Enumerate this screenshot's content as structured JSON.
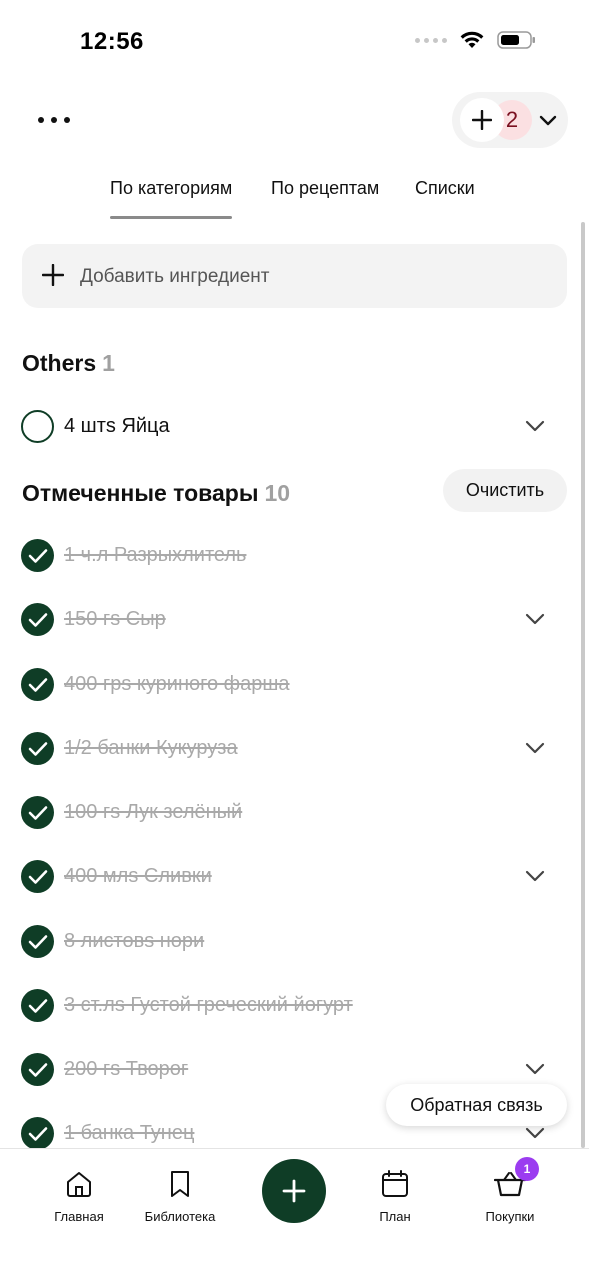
{
  "status_bar": {
    "time": "12:56"
  },
  "header": {
    "servings_count": "2"
  },
  "tabs": [
    {
      "label": "По категориям",
      "active": true
    },
    {
      "label": "По рецептам",
      "active": false
    },
    {
      "label": "Списки",
      "active": false
    }
  ],
  "add_ingredient": {
    "label": "Добавить ингредиент"
  },
  "sections": {
    "others": {
      "title": "Others",
      "count": "1",
      "items": [
        {
          "label": "4 штs Яйца",
          "checked": false,
          "expandable": true
        }
      ]
    },
    "checked": {
      "title": "Отмеченные товары",
      "count": "10",
      "clear_label": "Очистить",
      "items": [
        {
          "label": "1 ч.л Разрыхлитель",
          "checked": true,
          "expandable": false
        },
        {
          "label": "150 гs Сыр",
          "checked": true,
          "expandable": true
        },
        {
          "label": "400 грs куриного фарша",
          "checked": true,
          "expandable": false
        },
        {
          "label": "1/2 банки Кукуруза",
          "checked": true,
          "expandable": true
        },
        {
          "label": "100 гs Лук зелёный",
          "checked": true,
          "expandable": false
        },
        {
          "label": "400 млs Сливки",
          "checked": true,
          "expandable": true
        },
        {
          "label": "8 листовs нори",
          "checked": true,
          "expandable": false
        },
        {
          "label": "3 ст.лs Густой греческий йогурт",
          "checked": true,
          "expandable": false
        },
        {
          "label": "200 гs Творог",
          "checked": true,
          "expandable": true
        },
        {
          "label": "1 банка Тунец",
          "checked": true,
          "expandable": true
        }
      ]
    }
  },
  "feedback": {
    "label": "Обратная связь"
  },
  "bottom_nav": {
    "home": "Главная",
    "library": "Библиотека",
    "plan": "План",
    "shopping": "Покупки",
    "shopping_badge": "1"
  },
  "colors": {
    "accent": "#0f3d26",
    "badge": "#9b3cf0",
    "servings_bg": "#fbe0e2"
  }
}
